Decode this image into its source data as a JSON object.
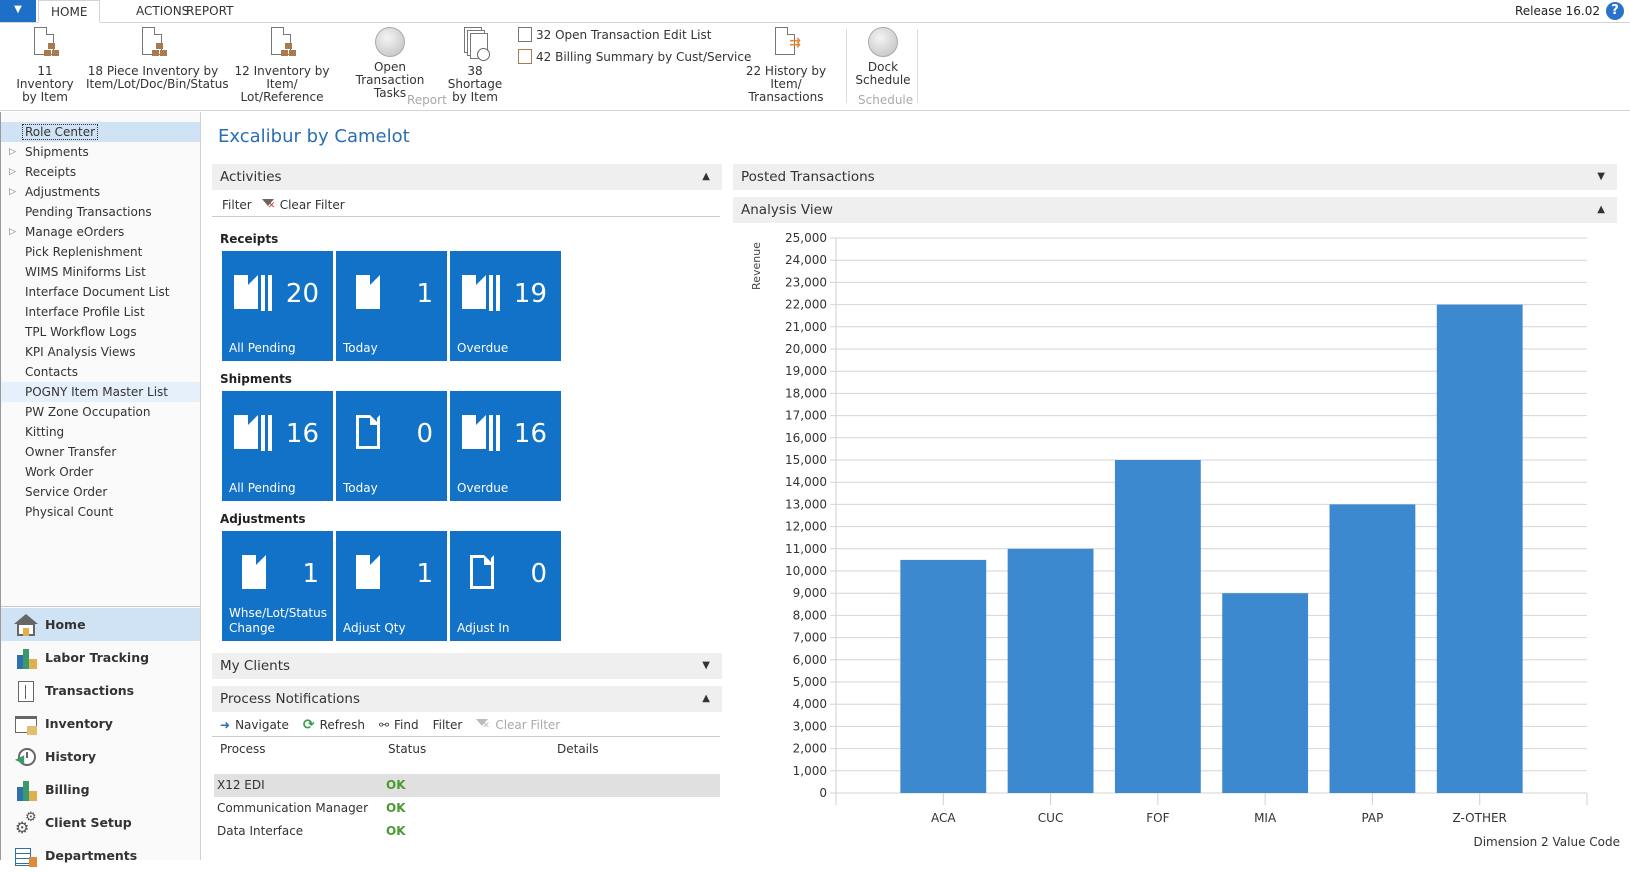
{
  "ribbon": {
    "tabs": [
      "HOME",
      "ACTIONS",
      "REPORT"
    ],
    "active_tab": "HOME",
    "release": "Release 16.02",
    "buttons": [
      {
        "line1": "11 Inventory",
        "line2": "by Item",
        "icon": "inventory-report-icon"
      },
      {
        "line1": "18  Piece Inventory by",
        "line2": "Item/Lot/Doc/Bin/Status",
        "icon": "inventory-report-icon"
      },
      {
        "line1": "12 Inventory by Item/",
        "line2": "Lot/Reference",
        "icon": "inventory-report-icon"
      },
      {
        "line1": "Open",
        "line2": "Transaction Tasks",
        "icon": "circle-icon"
      },
      {
        "line1": "38 Shortage",
        "line2": "by Item",
        "icon": "shortage-report-icon"
      },
      {
        "line1": "22  History by Item/",
        "line2": "Transactions",
        "icon": "history-report-icon"
      },
      {
        "line1": "Dock",
        "line2": "Schedule",
        "icon": "circle-icon"
      }
    ],
    "small_buttons": [
      {
        "label": "32  Open Transaction Edit List",
        "icon": "edit-list-report-icon"
      },
      {
        "label": "42  Billing Summary by Cust/Service",
        "icon": "billing-summary-report-icon"
      }
    ],
    "groups": [
      "Report",
      "Schedule"
    ]
  },
  "sidebar": {
    "items": [
      {
        "label": "Role Center",
        "expandable": false
      },
      {
        "label": "Shipments",
        "expandable": true
      },
      {
        "label": "Receipts",
        "expandable": true
      },
      {
        "label": "Adjustments",
        "expandable": true
      },
      {
        "label": "Pending Transactions",
        "expandable": false
      },
      {
        "label": "Manage eOrders",
        "expandable": true
      },
      {
        "label": "Pick Replenishment",
        "expandable": false
      },
      {
        "label": "WIMS Miniforms List",
        "expandable": false
      },
      {
        "label": "Interface Document List",
        "expandable": false
      },
      {
        "label": "Interface Profile List",
        "expandable": false
      },
      {
        "label": "TPL Workflow Logs",
        "expandable": false
      },
      {
        "label": "KPI Analysis Views",
        "expandable": false
      },
      {
        "label": "Contacts",
        "expandable": false
      },
      {
        "label": "POGNY Item Master List",
        "expandable": false
      },
      {
        "label": "PW Zone Occupation",
        "expandable": false
      },
      {
        "label": "Kitting",
        "expandable": false
      },
      {
        "label": "Owner Transfer",
        "expandable": false
      },
      {
        "label": "Work Order",
        "expandable": false
      },
      {
        "label": "Service Order",
        "expandable": false
      },
      {
        "label": "Physical Count",
        "expandable": false
      }
    ],
    "selected": "Role Center",
    "nav_buttons": [
      "Home",
      "Labor Tracking",
      "Transactions",
      "Inventory",
      "History",
      "Billing",
      "Client Setup",
      "Departments"
    ],
    "nav_selected": "Home"
  },
  "main": {
    "title": "Excalibur by Camelot",
    "activities": {
      "header": "Activities",
      "filter": "Filter",
      "clear_filter": "Clear Filter",
      "groups": [
        {
          "label": "Receipts",
          "cues": [
            {
              "value": "20",
              "caption": "All Pending",
              "icon": "documents-stack-icon"
            },
            {
              "value": "1",
              "caption": "Today",
              "icon": "document-icon"
            },
            {
              "value": "19",
              "caption": "Overdue",
              "icon": "documents-stack-icon"
            }
          ]
        },
        {
          "label": "Shipments",
          "cues": [
            {
              "value": "16",
              "caption": "All Pending",
              "icon": "documents-stack-icon"
            },
            {
              "value": "0",
              "caption": "Today",
              "icon": "document-outline-icon"
            },
            {
              "value": "16",
              "caption": "Overdue",
              "icon": "documents-stack-icon"
            }
          ]
        },
        {
          "label": "Adjustments",
          "cues": [
            {
              "value": "1",
              "caption": "Whse/Lot/Status Change",
              "icon": "document-icon"
            },
            {
              "value": "1",
              "caption": "Adjust Qty",
              "icon": "document-icon"
            },
            {
              "value": "0",
              "caption": "Adjust In",
              "icon": "document-outline-icon"
            }
          ]
        }
      ]
    },
    "my_clients": {
      "header": "My Clients"
    },
    "process_notifications": {
      "header": "Process Notifications",
      "actions": {
        "navigate": "Navigate",
        "refresh": "Refresh",
        "find": "Find",
        "filter": "Filter",
        "clear_filter": "Clear Filter"
      },
      "columns": [
        "Process",
        "Status",
        "Details"
      ],
      "rows": [
        {
          "process": "X12 EDI",
          "status": "OK",
          "details": ""
        },
        {
          "process": "Communication Manager",
          "status": "OK",
          "details": ""
        },
        {
          "process": "Data Interface",
          "status": "OK",
          "details": ""
        }
      ]
    },
    "posted_transactions": {
      "header": "Posted Transactions"
    },
    "analysis_view": {
      "header": "Analysis View"
    }
  },
  "colors": {
    "accent": "#1272c8",
    "bar": "#3d89cf",
    "title": "#2a6eb4",
    "ok": "#4a9a2f"
  },
  "chart_data": {
    "type": "bar",
    "title": "",
    "categories": [
      "ACA",
      "CUC",
      "FOF",
      "MIA",
      "PAP",
      "Z-OTHER"
    ],
    "values": [
      10500,
      11000,
      15000,
      9000,
      13000,
      22000
    ],
    "xlabel": "Dimension 2 Value Code",
    "ylabel": "Revenue",
    "ylim": [
      0,
      25000
    ],
    "ytick_step": 1000,
    "grid": true,
    "legend": "none"
  }
}
